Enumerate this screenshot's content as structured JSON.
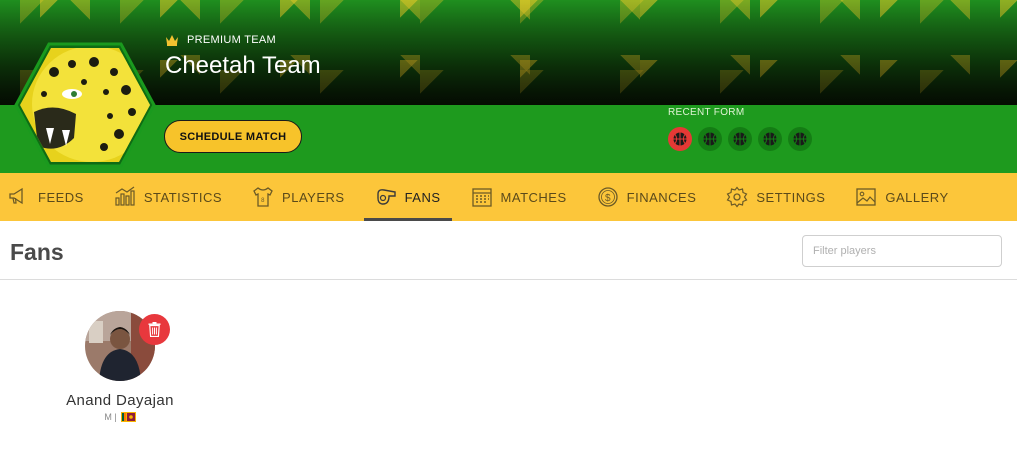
{
  "team": {
    "badge_label": "PREMIUM TEAM",
    "badge_icon": "crown-icon",
    "name": "Cheetah Team",
    "schedule_label": "SCHEDULE MATCH",
    "recent_form_label": "RECENT FORM",
    "recent_form": [
      "loss",
      "win",
      "win",
      "win",
      "win"
    ]
  },
  "nav": {
    "items": [
      {
        "label": "FEEDS",
        "icon": "megaphone-icon"
      },
      {
        "label": "STATISTICS",
        "icon": "bar-chart-icon"
      },
      {
        "label": "PLAYERS",
        "icon": "jersey-icon"
      },
      {
        "label": "FANS",
        "icon": "whistle-icon",
        "active": true
      },
      {
        "label": "MATCHES",
        "icon": "calendar-icon"
      },
      {
        "label": "FINANCES",
        "icon": "dollar-coin-icon"
      },
      {
        "label": "SETTINGS",
        "icon": "gear-icon"
      },
      {
        "label": "GALLERY",
        "icon": "image-icon"
      }
    ]
  },
  "page": {
    "title": "Fans",
    "filter_placeholder": "Filter players",
    "filter_value": ""
  },
  "fans": [
    {
      "name": "Anand Dayajan",
      "meta": "M |",
      "flag": "sri-lanka-flag-icon"
    }
  ],
  "colors": {
    "accent_yellow": "#fcc63a",
    "brand_green": "#1e9a1e",
    "loss_red": "#e53935",
    "delete_red": "#e8383d"
  }
}
